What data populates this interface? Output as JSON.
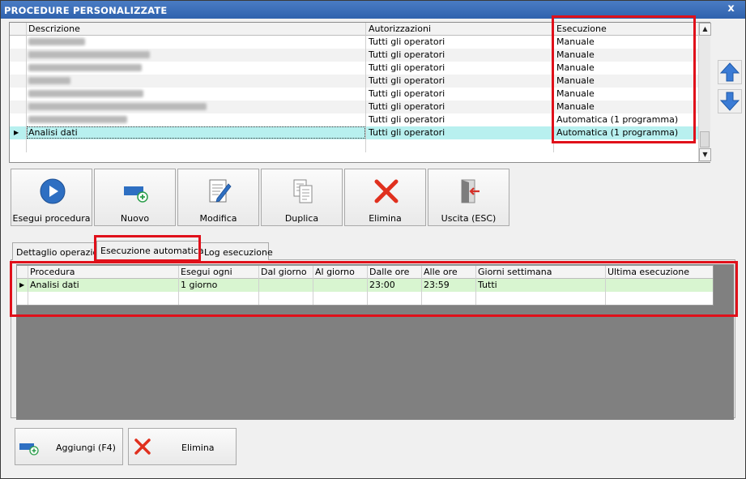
{
  "window": {
    "title": "PROCEDURE PERSONALIZZATE",
    "close_glyph": "x"
  },
  "procedures_grid": {
    "columns": [
      "Descrizione",
      "Autorizzazioni",
      "Esecuzione"
    ],
    "rows": [
      {
        "descrizione": "",
        "autorizzazioni": "Tutti gli operatori",
        "esecuzione": "Manuale",
        "blurred": true
      },
      {
        "descrizione": "",
        "autorizzazioni": "Tutti gli operatori",
        "esecuzione": "Manuale",
        "blurred": true
      },
      {
        "descrizione": "",
        "autorizzazioni": "Tutti gli operatori",
        "esecuzione": "Manuale",
        "blurred": true
      },
      {
        "descrizione": "",
        "autorizzazioni": "Tutti gli operatori",
        "esecuzione": "Manuale",
        "blurred": true
      },
      {
        "descrizione": "",
        "autorizzazioni": "Tutti gli operatori",
        "esecuzione": "Manuale",
        "blurred": true
      },
      {
        "descrizione": "",
        "autorizzazioni": "Tutti gli operatori",
        "esecuzione": "Manuale",
        "blurred": true
      },
      {
        "descrizione": "",
        "autorizzazioni": "Tutti gli operatori",
        "esecuzione": "Automatica (1 programma)",
        "blurred": true
      },
      {
        "descrizione": "Analisi dati",
        "autorizzazioni": "Tutti gli operatori",
        "esecuzione": "Automatica (1 programma)",
        "selected": true
      }
    ]
  },
  "toolbar": {
    "buttons": [
      {
        "label": "Esegui procedura",
        "icon": "play-icon"
      },
      {
        "label": "Nuovo",
        "icon": "add-icon"
      },
      {
        "label": "Modifica",
        "icon": "edit-document-icon"
      },
      {
        "label": "Duplica",
        "icon": "copy-document-icon"
      },
      {
        "label": "Elimina",
        "icon": "delete-x-icon"
      },
      {
        "label": "Uscita (ESC)",
        "icon": "exit-door-icon"
      }
    ]
  },
  "tabs": [
    {
      "label": "Dettaglio operazioni",
      "active": false
    },
    {
      "label": "Esecuzione automatica",
      "active": true
    },
    {
      "label": "Log esecuzione",
      "active": false
    }
  ],
  "schedule_grid": {
    "columns": [
      "Procedura",
      "Esegui ogni",
      "Dal giorno",
      "Al giorno",
      "Dalle ore",
      "Alle ore",
      "Giorni settimana",
      "Ultima esecuzione"
    ],
    "rows": [
      {
        "procedura": "Analisi dati",
        "esegui_ogni": "1 giorno",
        "dal_giorno": "",
        "al_giorno": "",
        "dalle_ore": "23:00",
        "alle_ore": "23:59",
        "giorni_settimana": "Tutti",
        "ultima_esecuzione": ""
      }
    ]
  },
  "bottom_buttons": {
    "add_label": "Aggiungi (F4)",
    "delete_label": "Elimina"
  },
  "colors": {
    "titlebar": "#2f62ad",
    "highlight_border": "#e0101a",
    "selected_row": "#b8f0ef",
    "schedule_row": "#d8f5d0",
    "arrow_blue": "#3a7bd5"
  }
}
